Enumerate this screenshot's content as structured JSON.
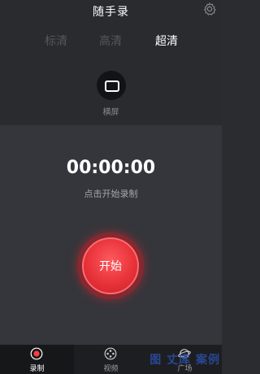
{
  "header": {
    "title": "随手录",
    "settings_icon": "gear-icon"
  },
  "quality": {
    "options": [
      "标清",
      "高清",
      "超清"
    ],
    "selected": "超清"
  },
  "orientation": {
    "label": "横屏",
    "icon": "landscape-icon"
  },
  "recorder": {
    "timer": "00:00:00",
    "hint": "点击开始录制",
    "start_label": "开始",
    "accent": "#e8333a"
  },
  "tabs": [
    {
      "label": "录制",
      "icon": "record-icon",
      "active": true
    },
    {
      "label": "视频",
      "icon": "film-reel-icon",
      "active": false
    },
    {
      "label": "广场",
      "icon": "planet-icon",
      "active": false
    }
  ],
  "watermark": "图 丈库 案例"
}
